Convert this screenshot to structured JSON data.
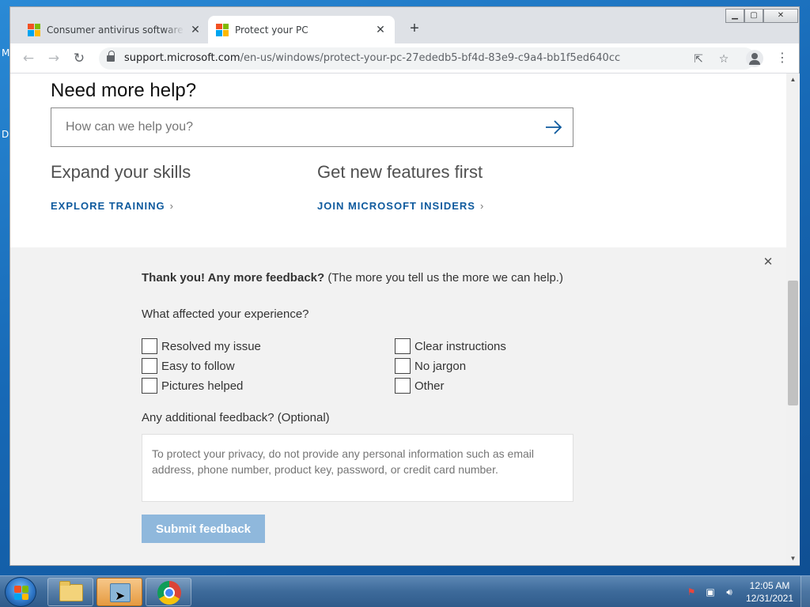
{
  "desktop": {
    "glyphs": [
      "M",
      "D"
    ]
  },
  "browser": {
    "tabs": [
      {
        "title": "Consumer antivirus software providers for Windows",
        "active": false
      },
      {
        "title": "Protect your PC",
        "active": true
      }
    ],
    "new_tab_glyph": "+",
    "url_host": "support.microsoft.com",
    "url_path": "/en-us/windows/protect-your-pc-27ededb5-bf4d-83e9-c9a4-bb1f5ed640cc"
  },
  "page": {
    "help_title": "Need more help?",
    "search_placeholder": "How can we help you?",
    "skills": [
      {
        "heading": "Expand your skills",
        "link": "EXPLORE TRAINING"
      },
      {
        "heading": "Get new features first",
        "link": "JOIN MICROSOFT INSIDERS"
      }
    ],
    "feedback": {
      "thanks_bold": "Thank you! Any more feedback?",
      "thanks_rest": " (The more you tell us the more we can help.)",
      "question": "What affected your experience?",
      "options": [
        "Resolved my issue",
        "Easy to follow",
        "Pictures helped",
        "Clear instructions",
        "No jargon",
        "Other"
      ],
      "additional_label": "Any additional feedback? (Optional)",
      "textarea_placeholder": "To protect your privacy, do not provide any personal information such as email address, phone number, product key, password, or credit card number.",
      "submit_label": "Submit feedback"
    }
  },
  "taskbar": {
    "time": "12:05 AM",
    "date": "12/31/2021"
  },
  "colors": {
    "link_blue": "#0e5a9e",
    "submit_disabled": "#8fb8dc",
    "ms_red": "#f25022",
    "ms_green": "#7fba00",
    "ms_blue": "#00a4ef",
    "ms_yellow": "#ffb900"
  }
}
